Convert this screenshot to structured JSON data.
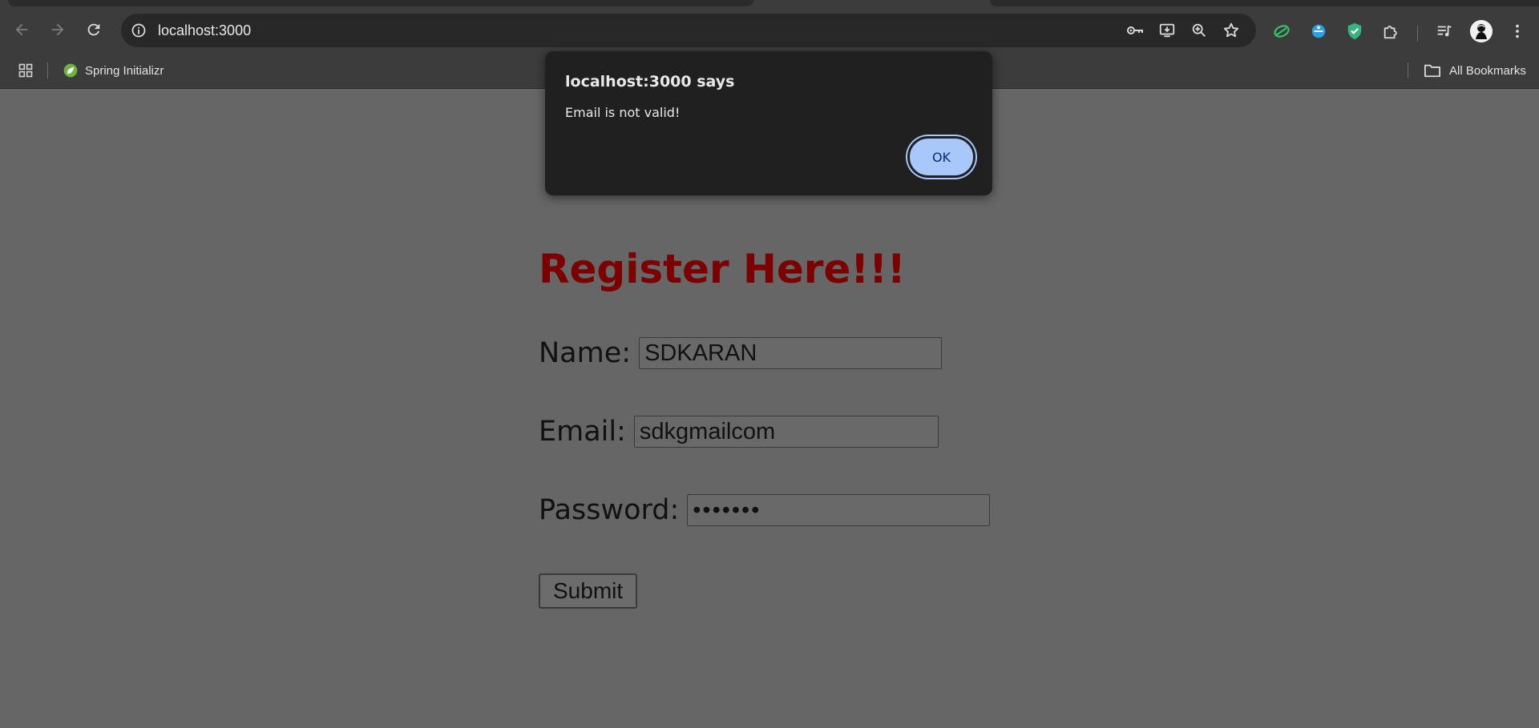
{
  "browser": {
    "url": "localhost:3000",
    "bookmarks": {
      "items": [
        {
          "label": "Spring Initializr",
          "icon": "spring-leaf-icon"
        }
      ],
      "all_bookmarks_label": "All Bookmarks"
    },
    "icons": {
      "back": "arrow-left-icon",
      "forward": "arrow-right-icon",
      "reload": "reload-icon",
      "site_info": "info-icon",
      "passwords": "key-icon",
      "install": "install-app-icon",
      "zoom": "zoom-icon",
      "bookmark": "star-icon",
      "extensions": [
        "leaf-extension-icon",
        "blue-extension-icon",
        "shield-extension-icon",
        "puzzle-icon"
      ],
      "media": "media-queue-icon",
      "menu": "kebab-menu-icon"
    }
  },
  "dialog": {
    "title": "localhost:3000 says",
    "message": "Email is not valid!",
    "ok_label": "OK"
  },
  "form": {
    "title": "Register Here!!!",
    "name_label": "Name:",
    "name_value": "SDKARAN",
    "email_label": "Email:",
    "email_value": "sdkgmailcom",
    "password_label": "Password:",
    "password_value": "•••••••",
    "submit_label": "Submit"
  },
  "colors": {
    "page_background": "#666666",
    "title": "#7d0000",
    "dialog_background": "#202020",
    "ok_button": "#a8c7fa"
  }
}
